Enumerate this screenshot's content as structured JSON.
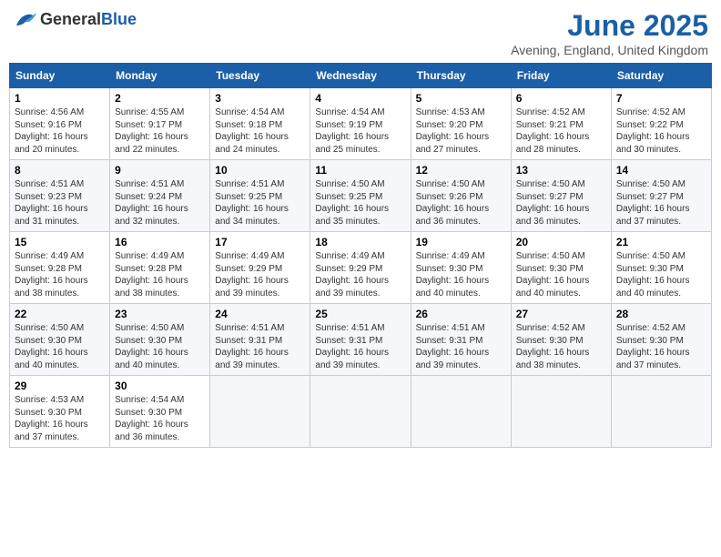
{
  "header": {
    "logo_general": "General",
    "logo_blue": "Blue",
    "month_year": "June 2025",
    "location": "Avening, England, United Kingdom"
  },
  "weekdays": [
    "Sunday",
    "Monday",
    "Tuesday",
    "Wednesday",
    "Thursday",
    "Friday",
    "Saturday"
  ],
  "weeks": [
    [
      {
        "day": "1",
        "sunrise": "4:56 AM",
        "sunset": "9:16 PM",
        "daylight": "16 hours and 20 minutes."
      },
      {
        "day": "2",
        "sunrise": "4:55 AM",
        "sunset": "9:17 PM",
        "daylight": "16 hours and 22 minutes."
      },
      {
        "day": "3",
        "sunrise": "4:54 AM",
        "sunset": "9:18 PM",
        "daylight": "16 hours and 24 minutes."
      },
      {
        "day": "4",
        "sunrise": "4:54 AM",
        "sunset": "9:19 PM",
        "daylight": "16 hours and 25 minutes."
      },
      {
        "day": "5",
        "sunrise": "4:53 AM",
        "sunset": "9:20 PM",
        "daylight": "16 hours and 27 minutes."
      },
      {
        "day": "6",
        "sunrise": "4:52 AM",
        "sunset": "9:21 PM",
        "daylight": "16 hours and 28 minutes."
      },
      {
        "day": "7",
        "sunrise": "4:52 AM",
        "sunset": "9:22 PM",
        "daylight": "16 hours and 30 minutes."
      }
    ],
    [
      {
        "day": "8",
        "sunrise": "4:51 AM",
        "sunset": "9:23 PM",
        "daylight": "16 hours and 31 minutes."
      },
      {
        "day": "9",
        "sunrise": "4:51 AM",
        "sunset": "9:24 PM",
        "daylight": "16 hours and 32 minutes."
      },
      {
        "day": "10",
        "sunrise": "4:51 AM",
        "sunset": "9:25 PM",
        "daylight": "16 hours and 34 minutes."
      },
      {
        "day": "11",
        "sunrise": "4:50 AM",
        "sunset": "9:25 PM",
        "daylight": "16 hours and 35 minutes."
      },
      {
        "day": "12",
        "sunrise": "4:50 AM",
        "sunset": "9:26 PM",
        "daylight": "16 hours and 36 minutes."
      },
      {
        "day": "13",
        "sunrise": "4:50 AM",
        "sunset": "9:27 PM",
        "daylight": "16 hours and 36 minutes."
      },
      {
        "day": "14",
        "sunrise": "4:50 AM",
        "sunset": "9:27 PM",
        "daylight": "16 hours and 37 minutes."
      }
    ],
    [
      {
        "day": "15",
        "sunrise": "4:49 AM",
        "sunset": "9:28 PM",
        "daylight": "16 hours and 38 minutes."
      },
      {
        "day": "16",
        "sunrise": "4:49 AM",
        "sunset": "9:28 PM",
        "daylight": "16 hours and 38 minutes."
      },
      {
        "day": "17",
        "sunrise": "4:49 AM",
        "sunset": "9:29 PM",
        "daylight": "16 hours and 39 minutes."
      },
      {
        "day": "18",
        "sunrise": "4:49 AM",
        "sunset": "9:29 PM",
        "daylight": "16 hours and 39 minutes."
      },
      {
        "day": "19",
        "sunrise": "4:49 AM",
        "sunset": "9:30 PM",
        "daylight": "16 hours and 40 minutes."
      },
      {
        "day": "20",
        "sunrise": "4:50 AM",
        "sunset": "9:30 PM",
        "daylight": "16 hours and 40 minutes."
      },
      {
        "day": "21",
        "sunrise": "4:50 AM",
        "sunset": "9:30 PM",
        "daylight": "16 hours and 40 minutes."
      }
    ],
    [
      {
        "day": "22",
        "sunrise": "4:50 AM",
        "sunset": "9:30 PM",
        "daylight": "16 hours and 40 minutes."
      },
      {
        "day": "23",
        "sunrise": "4:50 AM",
        "sunset": "9:30 PM",
        "daylight": "16 hours and 40 minutes."
      },
      {
        "day": "24",
        "sunrise": "4:51 AM",
        "sunset": "9:31 PM",
        "daylight": "16 hours and 39 minutes."
      },
      {
        "day": "25",
        "sunrise": "4:51 AM",
        "sunset": "9:31 PM",
        "daylight": "16 hours and 39 minutes."
      },
      {
        "day": "26",
        "sunrise": "4:51 AM",
        "sunset": "9:31 PM",
        "daylight": "16 hours and 39 minutes."
      },
      {
        "day": "27",
        "sunrise": "4:52 AM",
        "sunset": "9:30 PM",
        "daylight": "16 hours and 38 minutes."
      },
      {
        "day": "28",
        "sunrise": "4:52 AM",
        "sunset": "9:30 PM",
        "daylight": "16 hours and 37 minutes."
      }
    ],
    [
      {
        "day": "29",
        "sunrise": "4:53 AM",
        "sunset": "9:30 PM",
        "daylight": "16 hours and 37 minutes."
      },
      {
        "day": "30",
        "sunrise": "4:54 AM",
        "sunset": "9:30 PM",
        "daylight": "16 hours and 36 minutes."
      },
      null,
      null,
      null,
      null,
      null
    ]
  ]
}
